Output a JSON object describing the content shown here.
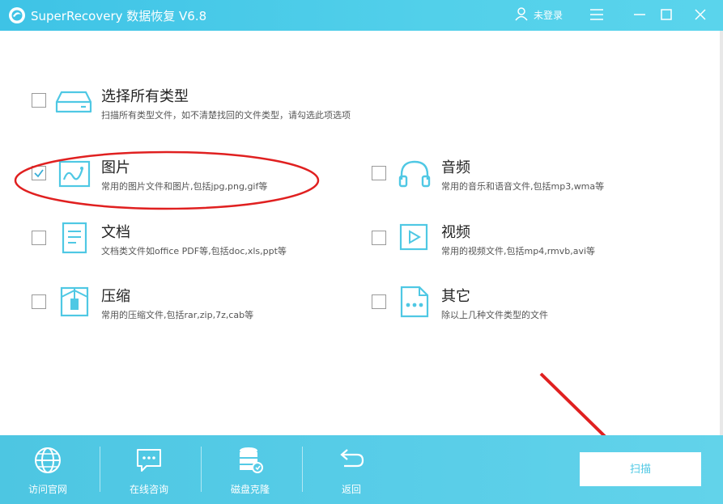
{
  "window": {
    "title": "SuperRecovery 数据恢复 V6.8",
    "user_label": "未登录"
  },
  "options": [
    {
      "title": "选择所有类型",
      "desc": "扫描所有类型文件，如不清楚找回的文件类型，请勾选此项选项",
      "checked": false,
      "icon": "drive-icon"
    },
    {
      "title": "图片",
      "desc": "常用的图片文件和图片,包括jpg,png,gif等",
      "checked": true,
      "icon": "image-icon"
    },
    {
      "title": "音频",
      "desc": "常用的音乐和语音文件,包括mp3,wma等",
      "checked": false,
      "icon": "headphones-icon"
    },
    {
      "title": "文档",
      "desc": "文档类文件如office PDF等,包括doc,xls,ppt等",
      "checked": false,
      "icon": "document-icon"
    },
    {
      "title": "视频",
      "desc": "常用的视频文件,包括mp4,rmvb,avi等",
      "checked": false,
      "icon": "video-icon"
    },
    {
      "title": "压缩",
      "desc": "常用的压缩文件,包括rar,zip,7z,cab等",
      "checked": false,
      "icon": "archive-icon"
    },
    {
      "title": "其它",
      "desc": "除以上几种文件类型的文件",
      "checked": false,
      "icon": "other-file-icon"
    }
  ],
  "toolbar": {
    "items": [
      {
        "label": "访问官网",
        "icon": "globe-icon"
      },
      {
        "label": "在线咨询",
        "icon": "chat-icon"
      },
      {
        "label": "磁盘克隆",
        "icon": "database-icon"
      },
      {
        "label": "返回",
        "icon": "return-icon"
      }
    ],
    "scan_label": "扫描"
  },
  "colors": {
    "accent": "#4fc8e4",
    "annotation": "#e02020"
  }
}
